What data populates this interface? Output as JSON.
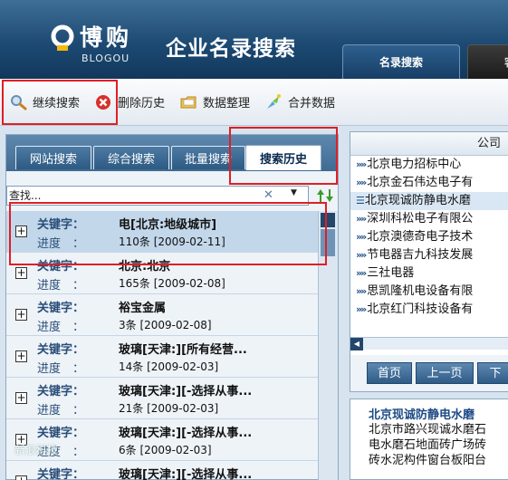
{
  "header": {
    "logo_cn": "博购",
    "logo_en": "BLOGOU",
    "app_title": "企业名录搜索",
    "tabs": [
      {
        "label": "名录搜索",
        "active": true
      },
      {
        "label": "客",
        "active": false
      }
    ]
  },
  "toolbar": {
    "items": [
      {
        "label": "继续搜索",
        "icon": "magnifier-icon"
      },
      {
        "label": "删除历史",
        "icon": "delete-x-icon"
      },
      {
        "label": "数据整理",
        "icon": "folder-icon"
      },
      {
        "label": "合并数据",
        "icon": "merge-icon"
      }
    ]
  },
  "left_panel": {
    "tabs": [
      {
        "label": "网站搜索",
        "active": false
      },
      {
        "label": "综合搜索",
        "active": false
      },
      {
        "label": "批量搜索",
        "active": false
      },
      {
        "label": "搜索历史",
        "active": true
      }
    ],
    "search": {
      "value": "查找..."
    },
    "history_labels": {
      "keyword": "关键字：",
      "progress": "进度　："
    },
    "history": [
      {
        "keyword": "电[北京:地级城市]",
        "progress": "110条 [2009-02-11]",
        "selected": true
      },
      {
        "keyword": "北京:北京",
        "progress": "165条 [2009-02-08]",
        "selected": false
      },
      {
        "keyword": "裕宝金属",
        "progress": "3条 [2009-02-08]",
        "selected": false
      },
      {
        "keyword": "玻璃[天津:][所有经营...",
        "progress": "14条 [2009-02-03]",
        "selected": false
      },
      {
        "keyword": "玻璃[天津:][-选择从事...",
        "progress": "21条 [2009-02-03]",
        "selected": false
      },
      {
        "keyword": "玻璃[天津:][-选择从事...",
        "progress": "6条 [2009-02-03]",
        "selected": false
      },
      {
        "keyword": "玻璃[天津:][-选择从事...",
        "progress": "",
        "selected": false
      }
    ],
    "watermark": "新浪科技"
  },
  "right_panel": {
    "header": "公司",
    "companies": [
      {
        "name": "北京电力招标中心",
        "selected": false
      },
      {
        "name": "北京金石伟达电子有",
        "selected": false
      },
      {
        "name": "北京现诚防静电水磨",
        "selected": true
      },
      {
        "name": "深圳科松电子有限公",
        "selected": false
      },
      {
        "name": "北京澳德奇电子技术",
        "selected": false
      },
      {
        "name": "节电器吉九科技发展",
        "selected": false
      },
      {
        "name": "三社电器",
        "selected": false
      },
      {
        "name": "思凯隆机电设备有限",
        "selected": false
      },
      {
        "name": "北京红门科技设备有",
        "selected": false
      }
    ],
    "pager": {
      "first": "首页",
      "prev": "上一页",
      "next": "下"
    },
    "detail": {
      "title": "北京现诚防静电水磨",
      "lines": [
        "北京市路兴现诚水磨石",
        "电水磨石地面砖广场砖",
        "砖水泥构件窗台板阳台"
      ]
    }
  },
  "colors": {
    "highlight": "#e01e25",
    "header_bg": "#1d4a73",
    "selected_row": "#c3d7ea"
  }
}
